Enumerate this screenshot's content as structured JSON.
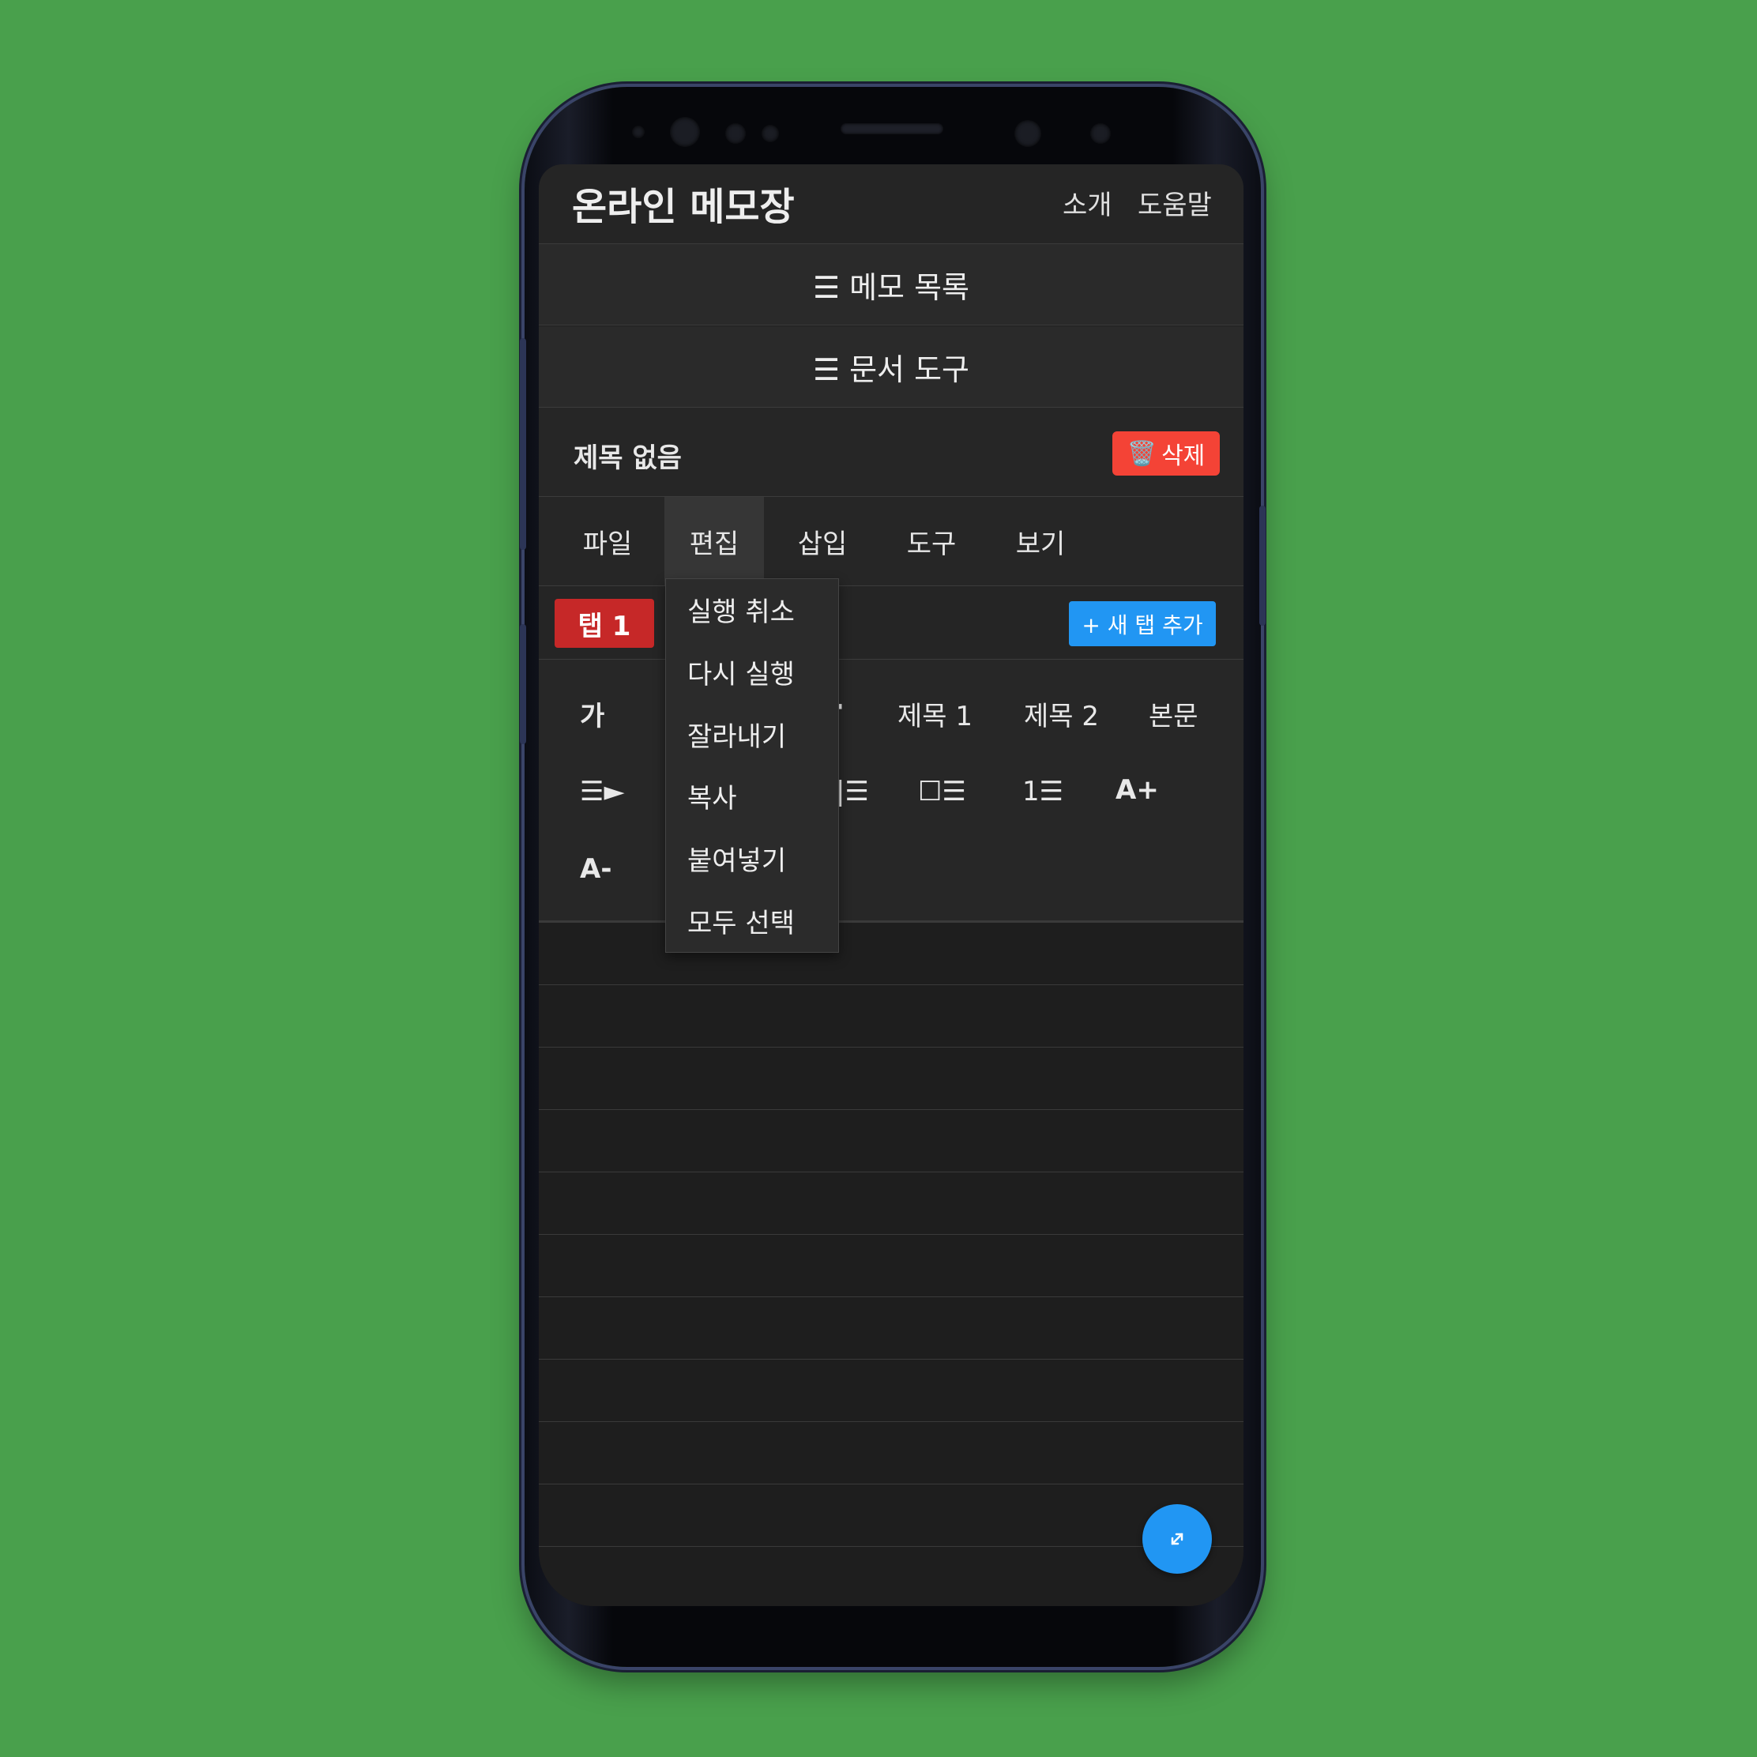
{
  "app": {
    "title": "온라인 메모장",
    "nav": {
      "about": "소개",
      "help": "도움말"
    }
  },
  "sections": {
    "memo_list": "☰ 메모 목록",
    "doc_tools": "☰ 문서 도구"
  },
  "memo": {
    "title": "제목 없음",
    "delete_icon": "🗑️",
    "delete_label": "삭제"
  },
  "menubar": {
    "items": [
      {
        "label": "파일"
      },
      {
        "label": "편집"
      },
      {
        "label": "삽입"
      },
      {
        "label": "도구"
      },
      {
        "label": "보기"
      }
    ],
    "active": "편집"
  },
  "tabs": {
    "active_tab": "탭 1",
    "add_tab": "+ 새 탭 추가"
  },
  "toolbar": {
    "bold": "가",
    "dot": "·",
    "heading1": "제목 1",
    "heading2": "제목 2",
    "body": "본문",
    "indent": "☰►",
    "list_fragment": "|☰",
    "checklist": "☐☰",
    "numbered_list": "1☰",
    "font_increase": "A+",
    "font_decrease": "A-"
  },
  "edit_menu": {
    "items": [
      "실행 취소",
      "다시 실행",
      "잘라내기",
      "복사",
      "붙여넣기",
      "모두 선택"
    ]
  },
  "fab": {
    "icon": "expand-icon",
    "glyph": "⤢"
  },
  "colors": {
    "background": "#49a04c",
    "delete": "#f44336",
    "tab_active": "#c62828",
    "primary": "#2196f3",
    "surface": "#1e1e1e"
  }
}
